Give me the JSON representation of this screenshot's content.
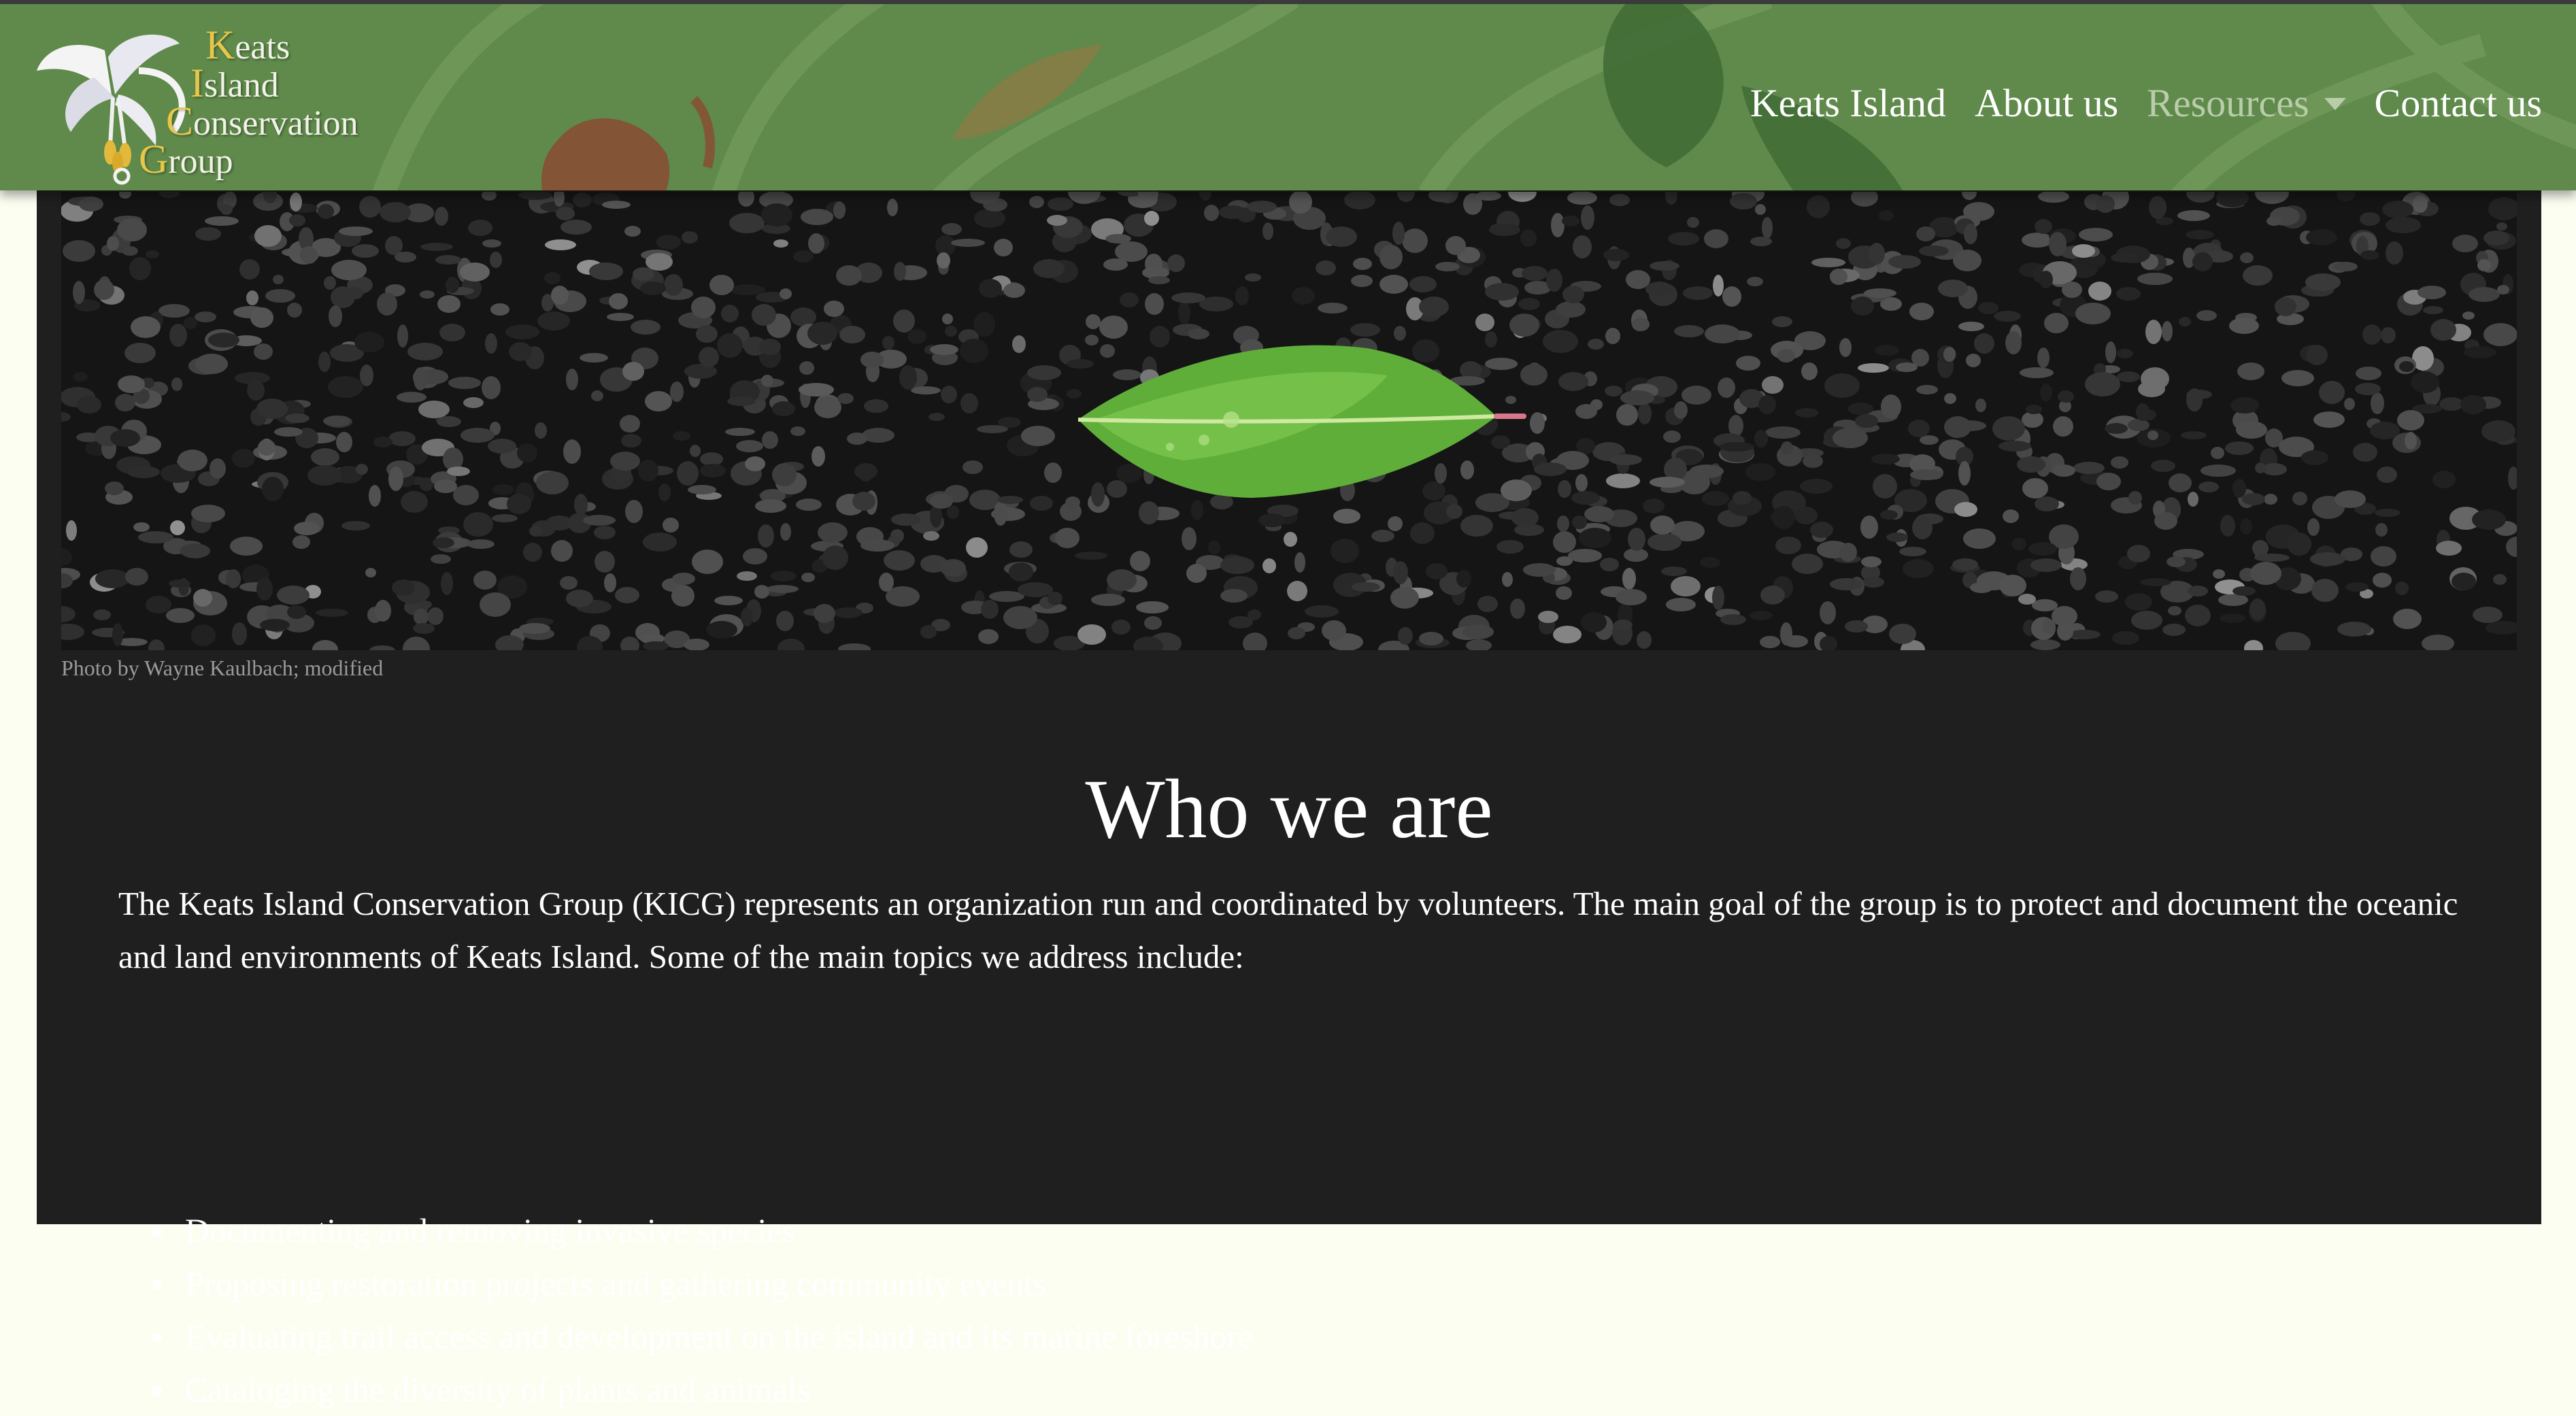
{
  "brand": {
    "words": [
      {
        "cap": "K",
        "rest": "eats"
      },
      {
        "cap": "I",
        "rest": "sland"
      },
      {
        "cap": "C",
        "rest": "onservation"
      },
      {
        "cap": "G",
        "rest": "roup"
      }
    ],
    "logo_icon": "lily-flower-icon"
  },
  "nav": {
    "items": [
      {
        "label": "Keats Island"
      },
      {
        "label": "About us"
      },
      {
        "label": "Resources",
        "has_dropdown": true,
        "dropdown_icon": "caret-down-icon"
      },
      {
        "label": "Contact us"
      }
    ]
  },
  "hero": {
    "caption": "Photo by Wayne Kaulbach; modified"
  },
  "main": {
    "heading": "Who we are",
    "intro": "The Keats Island Conservation Group (KICG) represents an organization run and coordinated by volunteers. The main goal of the group is to protect and document the oceanic and land environments of Keats Island. Some of the main topics we address include:",
    "topics": [
      "Documenting and removing invasive species",
      "Proposing restoration projects and gathering community events",
      "Evaluating trail access and development on the island and its marine foreshore",
      "Cataloging the diversity of plants and animals"
    ]
  },
  "colors": {
    "page_bg": "#fdfef2",
    "navbar_green": "#5f8a4b",
    "content_bg": "#1f1f1f",
    "brand_capital": "#e6c74a",
    "muted_nav": "#b9cdaa"
  }
}
